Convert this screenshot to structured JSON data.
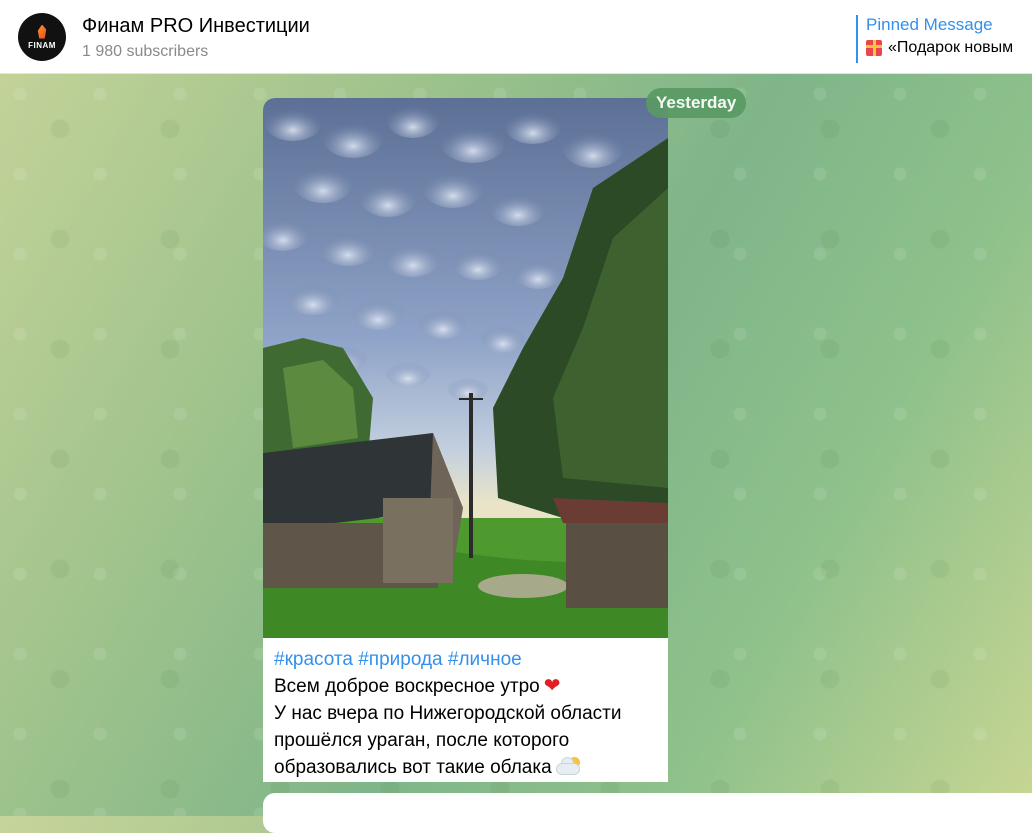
{
  "header": {
    "avatar_text": "FINAM",
    "channel_title": "Финам PRO Инвестиции",
    "subscribers": "1 980 subscribers",
    "pinned_label": "Pinned Message",
    "pinned_text": "«Подарок новым"
  },
  "date_badge": "Yesterday",
  "message": {
    "tags": [
      "#красота",
      "#природа",
      "#личное"
    ],
    "lines": [
      "Всем доброе воскресное утро",
      "У нас вчера по Нижегородской области",
      "прошёлся ураган, после которого",
      "образовались вот такие облака"
    ],
    "icons": [
      "gift-icon",
      "heart-icon",
      "cloud-sun-icon"
    ]
  },
  "colors": {
    "accent": "#3390ec",
    "date_badge_bg": "#5a9a63",
    "heart": "#e11d26"
  }
}
